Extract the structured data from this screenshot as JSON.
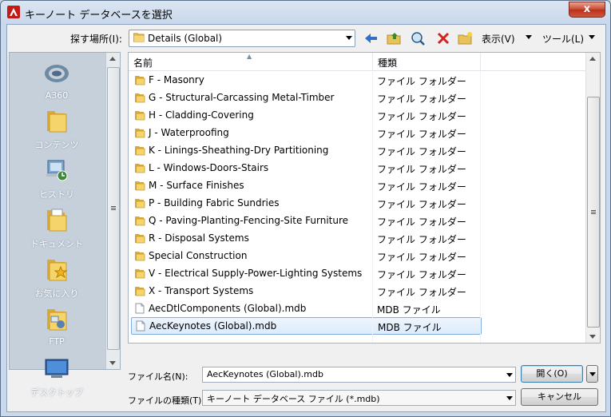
{
  "window": {
    "title": "キーノート データベースを選択",
    "close_label": "x"
  },
  "lookin": {
    "label": "探す場所(I):",
    "value": "Details (Global)"
  },
  "toolbar": {
    "views_label": "表示(V)",
    "tools_label": "ツール(L)"
  },
  "places": [
    {
      "name": "a360",
      "label": "A360"
    },
    {
      "name": "content",
      "label": "コンテンツ"
    },
    {
      "name": "history",
      "label": "ヒストリ"
    },
    {
      "name": "documents",
      "label": "ドキュメント"
    },
    {
      "name": "favorites",
      "label": "お気に入り"
    },
    {
      "name": "ftp",
      "label": "FTP"
    },
    {
      "name": "desktop",
      "label": "デスクトップ"
    }
  ],
  "filelist": {
    "columns": {
      "name": "名前",
      "type": "種類"
    },
    "rows": [
      {
        "name": "F - Masonry",
        "type": "ファイル フォルダー",
        "kind": "folder"
      },
      {
        "name": "G - Structural-Carcassing Metal-Timber",
        "type": "ファイル フォルダー",
        "kind": "folder"
      },
      {
        "name": "H - Cladding-Covering",
        "type": "ファイル フォルダー",
        "kind": "folder"
      },
      {
        "name": "J - Waterproofing",
        "type": "ファイル フォルダー",
        "kind": "folder"
      },
      {
        "name": "K - Linings-Sheathing-Dry Partitioning",
        "type": "ファイル フォルダー",
        "kind": "folder"
      },
      {
        "name": "L - Windows-Doors-Stairs",
        "type": "ファイル フォルダー",
        "kind": "folder"
      },
      {
        "name": "M - Surface Finishes",
        "type": "ファイル フォルダー",
        "kind": "folder"
      },
      {
        "name": "P - Building Fabric Sundries",
        "type": "ファイル フォルダー",
        "kind": "folder"
      },
      {
        "name": "Q - Paving-Planting-Fencing-Site Furniture",
        "type": "ファイル フォルダー",
        "kind": "folder"
      },
      {
        "name": "R - Disposal Systems",
        "type": "ファイル フォルダー",
        "kind": "folder"
      },
      {
        "name": "Special Construction",
        "type": "ファイル フォルダー",
        "kind": "folder"
      },
      {
        "name": "V - Electrical Supply-Power-Lighting Systems",
        "type": "ファイル フォルダー",
        "kind": "folder"
      },
      {
        "name": "X - Transport Systems",
        "type": "ファイル フォルダー",
        "kind": "folder"
      },
      {
        "name": "AecDtlComponents (Global).mdb",
        "type": "MDB ファイル",
        "kind": "file"
      },
      {
        "name": "AecKeynotes (Global).mdb",
        "type": "MDB ファイル",
        "kind": "file",
        "selected": true
      }
    ]
  },
  "filename": {
    "label": "ファイル名(N):",
    "value": "AecKeynotes (Global).mdb"
  },
  "filetype": {
    "label": "ファイルの種類(T):",
    "value": "キーノート データベース ファイル (*.mdb)"
  },
  "buttons": {
    "open": "開く(O)",
    "cancel": "キャンセル"
  }
}
